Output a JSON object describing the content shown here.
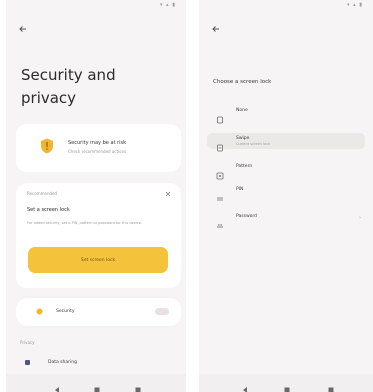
{
  "left": {
    "title": "Security and privacy",
    "status_card": {
      "title": "Security may be at risk",
      "subtitle": "Check recommended actions",
      "icon": "shield-icon"
    },
    "lock_card": {
      "eyebrow": "Recommended",
      "title": "Set a screen lock",
      "description": "For added security, set a PIN, pattern or password for this device.",
      "cta_label": "Set screen lock"
    },
    "security_item": {
      "label": "Security"
    },
    "privacy": {
      "header": "Privacy",
      "item_label": "Data sharing"
    }
  },
  "right": {
    "title": "Choose a screen lock",
    "options": [
      {
        "label": "None",
        "sub": "",
        "icon": "none-icon"
      },
      {
        "label": "Swipe",
        "sub": "Current screen lock",
        "icon": "swipe-icon"
      },
      {
        "label": "Pattern",
        "sub": "",
        "icon": "pattern-icon"
      },
      {
        "label": "PIN",
        "sub": "",
        "icon": "pin-icon"
      },
      {
        "label": "Password",
        "sub": "",
        "icon": "password-icon"
      }
    ]
  },
  "colors": {
    "accent": "#f5c33b",
    "background": "#f6f4f4",
    "card": "#ffffff"
  }
}
